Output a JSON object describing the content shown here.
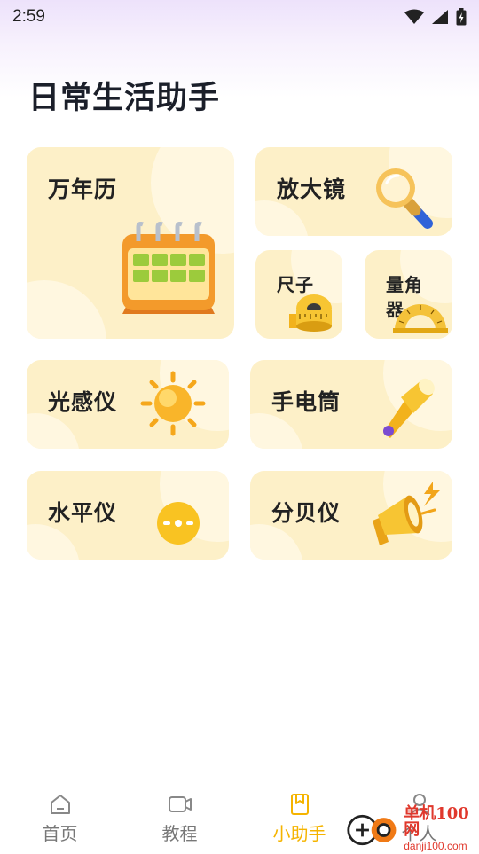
{
  "status_bar": {
    "time": "2:59"
  },
  "page": {
    "title": "日常生活助手"
  },
  "tools": {
    "calendar": {
      "label": "万年历",
      "icon": "calendar-icon"
    },
    "magnifier": {
      "label": "放大镜",
      "icon": "magnifier-icon"
    },
    "ruler": {
      "label": "尺子",
      "icon": "tape-measure-icon"
    },
    "protractor": {
      "label": "量角\n器",
      "icon": "protractor-icon"
    },
    "light_meter": {
      "label": "光感仪",
      "icon": "sun-icon"
    },
    "flashlight": {
      "label": "手电筒",
      "icon": "flashlight-icon"
    },
    "level": {
      "label": "水平仪",
      "icon": "level-icon"
    },
    "decibel_meter": {
      "label": "分贝仪",
      "icon": "megaphone-icon"
    }
  },
  "bottom_nav": {
    "items": [
      {
        "label": "首页",
        "icon": "home-icon",
        "active": false
      },
      {
        "label": "教程",
        "icon": "video-icon",
        "active": false
      },
      {
        "label": "小助手",
        "icon": "bookmark-icon",
        "active": true
      },
      {
        "label": "个人",
        "icon": "user-icon",
        "active": false
      }
    ]
  },
  "watermark": {
    "title": "单机100网",
    "url": "danji100.com"
  },
  "colors": {
    "card_bg": "#fdf0c8",
    "accent": "#f5b400",
    "header_tint": "#ede2fb"
  }
}
